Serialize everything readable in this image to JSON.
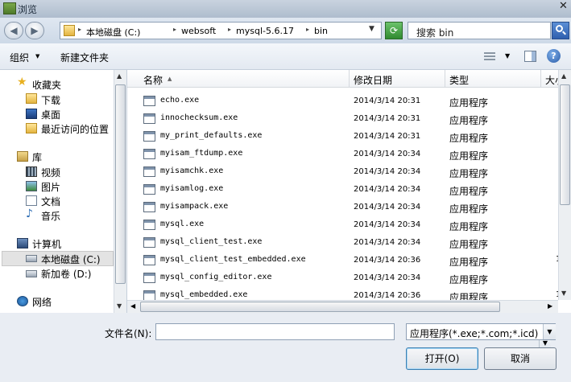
{
  "window": {
    "title": "浏览",
    "close": "✕"
  },
  "address": {
    "breadcrumbs": [
      "本地磁盘 (C:)",
      "websoft",
      "mysql-5.6.17",
      "bin"
    ],
    "search_placeholder": "搜索 bin"
  },
  "toolbar": {
    "organize": "组织",
    "new_folder": "新建文件夹"
  },
  "nav": {
    "favorites": "收藏夹",
    "downloads": "下载",
    "desktop": "桌面",
    "recent": "最近访问的位置",
    "libraries": "库",
    "videos": "视频",
    "pictures": "图片",
    "documents": "文档",
    "music": "音乐",
    "computer": "计算机",
    "local_disk": "本地磁盘 (C:)",
    "new_volume": "新加卷 (D:)",
    "network": "网络"
  },
  "columns": {
    "name": "名称",
    "date": "修改日期",
    "type": "类型",
    "size": "大小"
  },
  "files": [
    {
      "name": "echo.exe",
      "date": "2014/3/14 20:31",
      "type": "应用程序",
      "size": ""
    },
    {
      "name": "innochecksum.exe",
      "date": "2014/3/14 20:31",
      "type": "应用程序",
      "size": ""
    },
    {
      "name": "my_print_defaults.exe",
      "date": "2014/3/14 20:31",
      "type": "应用程序",
      "size": ""
    },
    {
      "name": "myisam_ftdump.exe",
      "date": "2014/3/14 20:34",
      "type": "应用程序",
      "size": ""
    },
    {
      "name": "myisamchk.exe",
      "date": "2014/3/14 20:34",
      "type": "应用程序",
      "size": ""
    },
    {
      "name": "myisamlog.exe",
      "date": "2014/3/14 20:34",
      "type": "应用程序",
      "size": ""
    },
    {
      "name": "myisampack.exe",
      "date": "2014/3/14 20:34",
      "type": "应用程序",
      "size": ""
    },
    {
      "name": "mysql.exe",
      "date": "2014/3/14 20:34",
      "type": "应用程序",
      "size": ""
    },
    {
      "name": "mysql_client_test.exe",
      "date": "2014/3/14 20:34",
      "type": "应用程序",
      "size": ""
    },
    {
      "name": "mysql_client_test_embedded.exe",
      "date": "2014/3/14 20:36",
      "type": "应用程序",
      "size": "1"
    },
    {
      "name": "mysql_config_editor.exe",
      "date": "2014/3/14 20:34",
      "type": "应用程序",
      "size": ""
    },
    {
      "name": "mysql_embedded.exe",
      "date": "2014/3/14 20:36",
      "type": "应用程序",
      "size": "1"
    }
  ],
  "bottom": {
    "filename_label": "文件名(N):",
    "filename_value": "",
    "filter": "应用程序(*.exe;*.com;*.icd)",
    "open": "打开(O)",
    "cancel": "取消"
  }
}
